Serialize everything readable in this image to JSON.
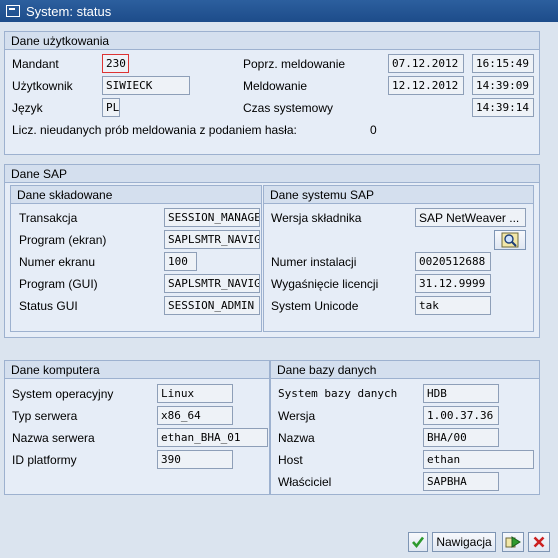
{
  "window": {
    "title": "System: status"
  },
  "user_data": {
    "title": "Dane użytkowania",
    "client_label": "Mandant",
    "client_value": "230",
    "user_label": "Użytkownik",
    "user_value": "SIWIECK",
    "language_label": "Język",
    "language_value": "PL",
    "prev_logon_label": "Poprz. meldowanie",
    "prev_logon_date": "07.12.2012",
    "prev_logon_time": "16:15:49",
    "logon_label": "Meldowanie",
    "logon_date": "12.12.2012",
    "logon_time": "14:39:09",
    "system_time_label": "Czas systemowy",
    "system_time_value": "14:39:14",
    "failed_label": "Licz. nieudanych prób meldowania z podaniem hasła:",
    "failed_value": "0"
  },
  "sap_data": {
    "title": "Dane SAP",
    "repository": {
      "title": "Dane składowane",
      "transaction_label": "Transakcja",
      "transaction_value": "SESSION_MANAGER",
      "program_screen_label": "Program (ekran)",
      "program_screen_value": "SAPLSMTR_NAVIGATION",
      "screen_number_label": "Numer ekranu",
      "screen_number_value": "100",
      "program_gui_label": "Program (GUI)",
      "program_gui_value": "SAPLSMTR_NAVIGATION",
      "gui_status_label": "Status GUI",
      "gui_status_value": "SESSION_ADMIN"
    },
    "system": {
      "title": "Dane systemu SAP",
      "component_label": "Wersja składnika",
      "component_value": "SAP NetWeaver ...",
      "installation_label": "Numer instalacji",
      "installation_value": "0020512688",
      "license_label": "Wygaśnięcie licencji",
      "license_value": "31.12.9999",
      "unicode_label": "System Unicode",
      "unicode_value": "tak"
    }
  },
  "host_data": {
    "title": "Dane komputera",
    "os_label": "System operacyjny",
    "os_value": "Linux",
    "server_type_label": "Typ serwera",
    "server_type_value": "x86_64",
    "server_name_label": "Nazwa serwera",
    "server_name_value": "ethan_BHA_01",
    "platform_label": "ID platformy",
    "platform_value": "390"
  },
  "db_data": {
    "title": "Dane bazy danych",
    "db_system_label": "System bazy danych",
    "db_system_value": "HDB",
    "version_label": "Wersja",
    "version_value": "1.00.37.36",
    "name_label": "Nazwa",
    "name_value": "BHA/00",
    "host_label": "Host",
    "host_value": "ethan",
    "owner_label": "Właściciel",
    "owner_value": "SAPBHA"
  },
  "buttons": {
    "navigation_label": "Nawigacja"
  },
  "colors": {
    "ok": "#2e9a2e",
    "cancel": "#cc2020",
    "title_bar": "#1d4c8a"
  }
}
